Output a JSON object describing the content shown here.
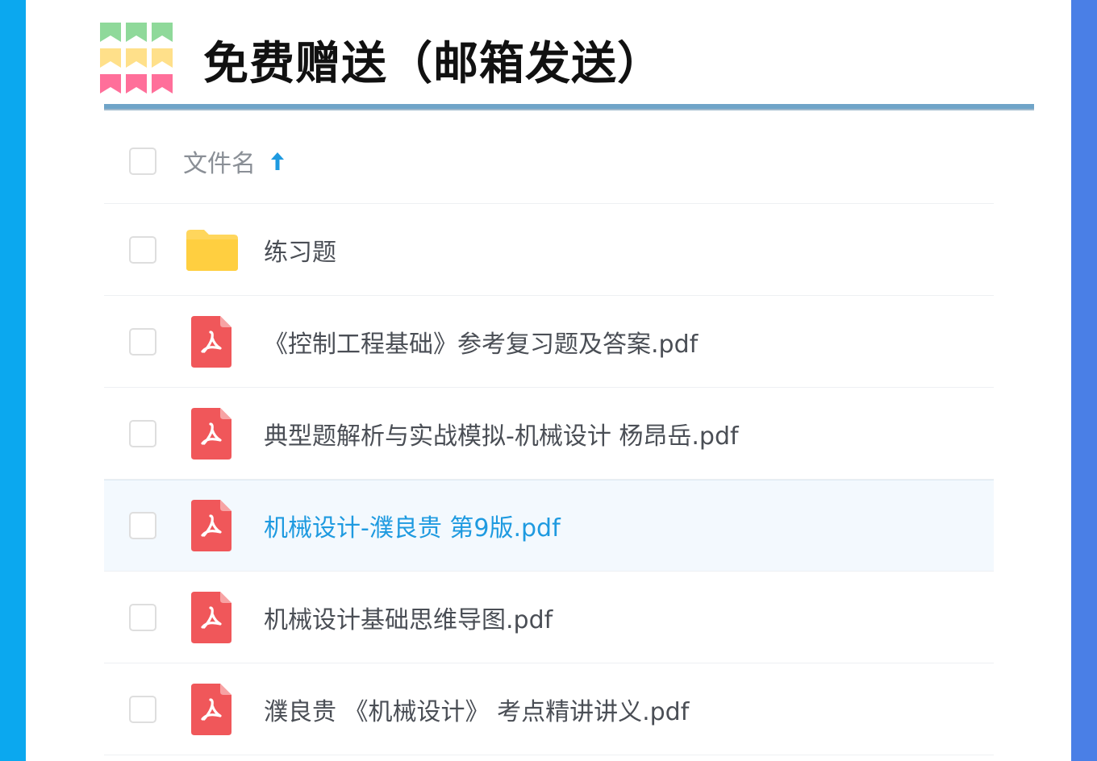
{
  "header": {
    "title": "免费赠送（邮箱发送）"
  },
  "colors": {
    "left_stripe": "#0ba8ef",
    "right_stripe": "#4a7fe6",
    "accent_link": "#1e9ae0",
    "pdf_red": "#f0575a",
    "folder_yellow": "#ffd65c"
  },
  "file_list": {
    "header": {
      "column_label": "文件名",
      "sort_icon": "arrow-up-icon"
    },
    "items": [
      {
        "name": "练习题",
        "type": "folder",
        "icon": "folder-icon",
        "highlighted": false
      },
      {
        "name": "《控制工程基础》参考复习题及答案.pdf",
        "type": "pdf",
        "icon": "pdf-icon",
        "highlighted": false
      },
      {
        "name": "典型题解析与实战模拟-机械设计 杨昂岳.pdf",
        "type": "pdf",
        "icon": "pdf-icon",
        "highlighted": false
      },
      {
        "name": "机械设计-濮良贵 第9版.pdf",
        "type": "pdf",
        "icon": "pdf-icon",
        "highlighted": true
      },
      {
        "name": "机械设计基础思维导图.pdf",
        "type": "pdf",
        "icon": "pdf-icon",
        "highlighted": false
      },
      {
        "name": "濮良贵 《机械设计》 考点精讲讲义.pdf",
        "type": "pdf",
        "icon": "pdf-icon",
        "highlighted": false
      }
    ]
  }
}
